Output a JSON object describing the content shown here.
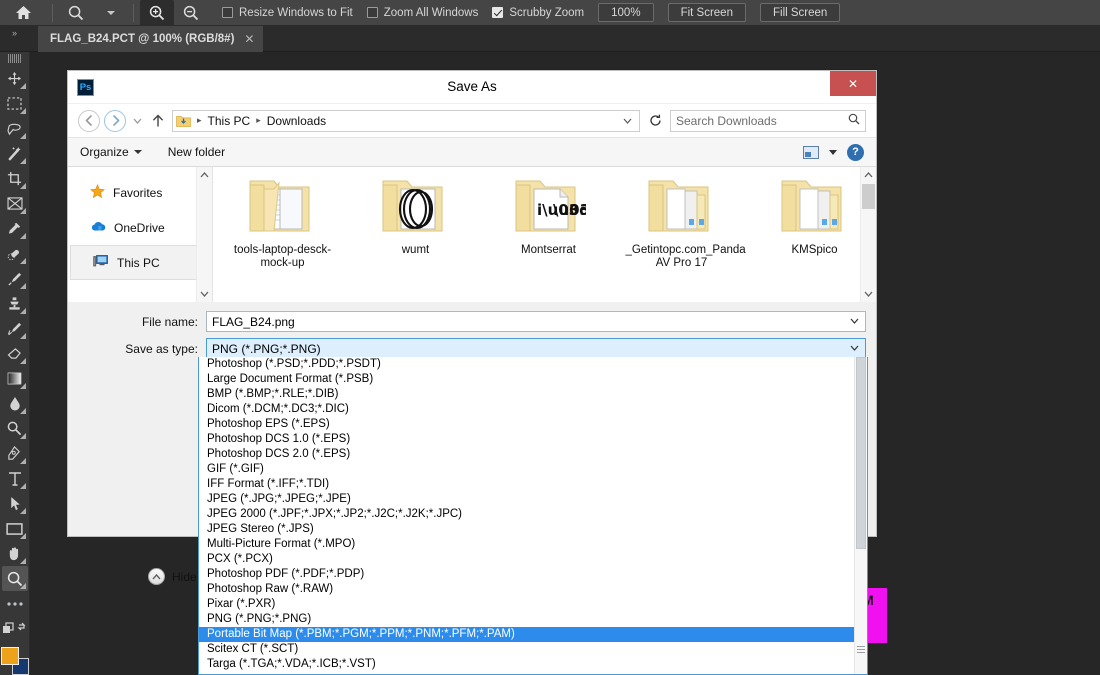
{
  "app": {
    "options_bar": {
      "home_icon": "home-icon",
      "zoom_tool_icon": "magnifier-icon",
      "zoom_tool_caret": "chevron-down-icon",
      "zoom_in_icon": "zoom-in-icon",
      "zoom_out_icon": "zoom-out-icon",
      "checkboxes": [
        {
          "label": "Resize Windows to Fit",
          "checked": false
        },
        {
          "label": "Zoom All Windows",
          "checked": false
        },
        {
          "label": "Scrubby Zoom",
          "checked": true
        }
      ],
      "buttons": [
        {
          "label": "100%"
        },
        {
          "label": "Fit Screen"
        },
        {
          "label": "Fill Screen"
        }
      ]
    },
    "tab_bar": {
      "collapse_label": "»",
      "document_tab": "FLAG_B24.PCT @ 100% (RGB/8#)",
      "close_glyph": "✕"
    },
    "tools": [
      {
        "name": "move-tool",
        "glyph": "✥"
      },
      {
        "name": "marquee-tool",
        "glyph": "⬚"
      },
      {
        "name": "lasso-tool",
        "glyph": "✄"
      },
      {
        "name": "magic-wand-tool",
        "glyph": "✨"
      },
      {
        "name": "crop-tool",
        "glyph": "✀"
      },
      {
        "name": "frame-tool",
        "glyph": "⌧"
      },
      {
        "name": "eyedropper-tool",
        "glyph": "✒"
      },
      {
        "name": "spot-healing-tool",
        "glyph": "⌕"
      },
      {
        "name": "brush-tool",
        "glyph": "✎"
      },
      {
        "name": "clone-stamp-tool",
        "glyph": "⚑"
      },
      {
        "name": "history-brush-tool",
        "glyph": "✐"
      },
      {
        "name": "eraser-tool",
        "glyph": "▱"
      },
      {
        "name": "gradient-tool",
        "glyph": "▧"
      },
      {
        "name": "blur-tool",
        "glyph": "●"
      },
      {
        "name": "dodge-tool",
        "glyph": "⚲"
      },
      {
        "name": "pen-tool",
        "glyph": "✑"
      },
      {
        "name": "type-tool",
        "glyph": "T"
      },
      {
        "name": "path-selection-tool",
        "glyph": "➤"
      },
      {
        "name": "rectangle-tool",
        "glyph": "▭"
      },
      {
        "name": "hand-tool",
        "glyph": "✋"
      },
      {
        "name": "zoom-tool",
        "glyph": "⌕",
        "selected": true
      },
      {
        "name": "edit-toolbar-tool",
        "glyph": "•••"
      }
    ],
    "swatches": {
      "foreground_color": "#eca21a",
      "background_color": "#15386e",
      "quick_mask_icon": "quick-mask-icon",
      "screen_mode_icon": "screen-mode-icon"
    },
    "canvas": {
      "document_sliver_color": "#f010f0",
      "document_sliver_char": "M"
    }
  },
  "dialog": {
    "app_icon_text": "Ps",
    "title": "Save As",
    "close_label": "✕",
    "nav": {
      "back_icon": "arrow-left-icon",
      "forward_icon": "arrow-right-icon",
      "recent_caret_icon": "chevron-down-icon",
      "up_icon": "arrow-up-icon",
      "breadcrumbs": [
        "This PC",
        "Downloads"
      ],
      "breadcrumb_separator": "▸",
      "address_caret_icon": "chevron-down-icon",
      "refresh_icon": "refresh-icon",
      "search_placeholder": "Search Downloads",
      "search_icon": "search-icon"
    },
    "toolbar": {
      "organize_label": "Organize",
      "organize_caret_icon": "caret-down-icon",
      "new_folder_label": "New folder",
      "view_icon": "view-layout-icon",
      "view_caret_icon": "caret-down-icon",
      "help_icon": "help-icon",
      "help_glyph": "?"
    },
    "sidebar": {
      "items": [
        {
          "label": "Favorites",
          "icon": "star-icon",
          "selected": false
        },
        {
          "label": "OneDrive",
          "icon": "cloud-icon",
          "selected": false
        },
        {
          "label": "This PC",
          "icon": "computer-icon",
          "selected": true
        }
      ],
      "scroll_up_icon": "chevron-up-icon",
      "scroll_down_icon": "chevron-down-icon"
    },
    "files": {
      "items": [
        {
          "name": "tools-laptop-desck-mock-up",
          "icon": "folder-icon"
        },
        {
          "name": "wumt",
          "icon": "folder-icon"
        },
        {
          "name": "Montserrat",
          "icon": "folder-icon"
        },
        {
          "name": "_Getintopc.com_Panda AV Pro 17",
          "icon": "folder-icon"
        },
        {
          "name": "KMSpico",
          "icon": "folder-icon"
        }
      ],
      "scroll_up_icon": "chevron-up-icon",
      "scroll_down_icon": "chevron-down-icon"
    },
    "form": {
      "file_name_label": "File name:",
      "file_name_value": "FLAG_B24.png",
      "file_name_caret_icon": "chevron-down-icon",
      "save_as_type_label": "Save as type:",
      "save_as_type_value": "PNG (*.PNG;*.PNG)",
      "save_as_type_caret_icon": "chevron-down-icon"
    },
    "hide_folders": {
      "label": "Hide Folders",
      "icon": "chevron-up-circle-icon"
    },
    "file_type_dropdown": {
      "selected_index": 18,
      "options": [
        "Photoshop (*.PSD;*.PDD;*.PSDT)",
        "Large Document Format (*.PSB)",
        "BMP (*.BMP;*.RLE;*.DIB)",
        "Dicom (*.DCM;*.DC3;*.DIC)",
        "Photoshop EPS (*.EPS)",
        "Photoshop DCS 1.0 (*.EPS)",
        "Photoshop DCS 2.0 (*.EPS)",
        "GIF (*.GIF)",
        "IFF Format (*.IFF;*.TDI)",
        "JPEG (*.JPG;*.JPEG;*.JPE)",
        "JPEG 2000 (*.JPF;*.JPX;*.JP2;*.J2C;*.J2K;*.JPC)",
        "JPEG Stereo (*.JPS)",
        "Multi-Picture Format (*.MPO)",
        "PCX (*.PCX)",
        "Photoshop PDF (*.PDF;*.PDP)",
        "Photoshop Raw (*.RAW)",
        "Pixar (*.PXR)",
        "PNG (*.PNG;*.PNG)",
        "Portable Bit Map (*.PBM;*.PGM;*.PPM;*.PNM;*.PFM;*.PAM)",
        "Scitex CT (*.SCT)",
        "Targa (*.TGA;*.VDA;*.ICB;*.VST)"
      ]
    }
  },
  "colors": {
    "accent_blue": "#2d8ceb",
    "dialog_bg": "#f0f0f0",
    "ps_chrome": "#454545",
    "close_red": "#c75050",
    "magenta": "#f010f0"
  }
}
